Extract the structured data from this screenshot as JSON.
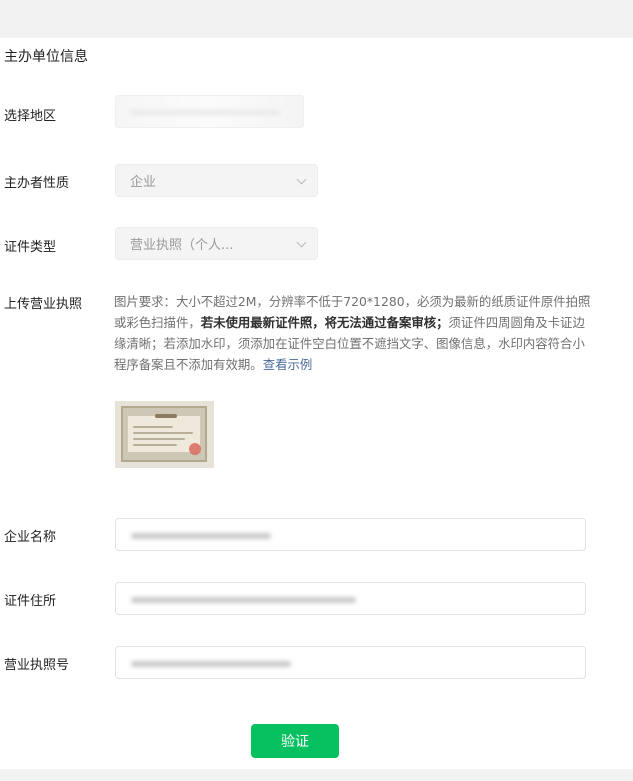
{
  "section_title": "主办单位信息",
  "rows": {
    "region": {
      "label": "选择地区"
    },
    "nature": {
      "label": "主办者性质",
      "value": "企业"
    },
    "cert_type": {
      "label": "证件类型",
      "value": "营业执照（个人..."
    },
    "upload": {
      "label": "上传营业执照",
      "req_1": "图片要求：大小不超过2M，分辨率不低于720*1280，必须为最新的纸质证件原件拍照或彩色扫描件，",
      "req_bold": "若未使用最新证件照，将无法通过备案审核；",
      "req_2": "须证件四周圆角及卡证边缘清晰；若添加水印，须添加在证件空白位置不遮挡文字、图像信息，水印内容符合小程序备案且不添加有效期。",
      "example_link": "查看示例"
    },
    "company_name": {
      "label": "企业名称"
    },
    "cert_address": {
      "label": "证件住所"
    },
    "license_no": {
      "label": "营业执照号"
    }
  },
  "verify_button": "验证"
}
